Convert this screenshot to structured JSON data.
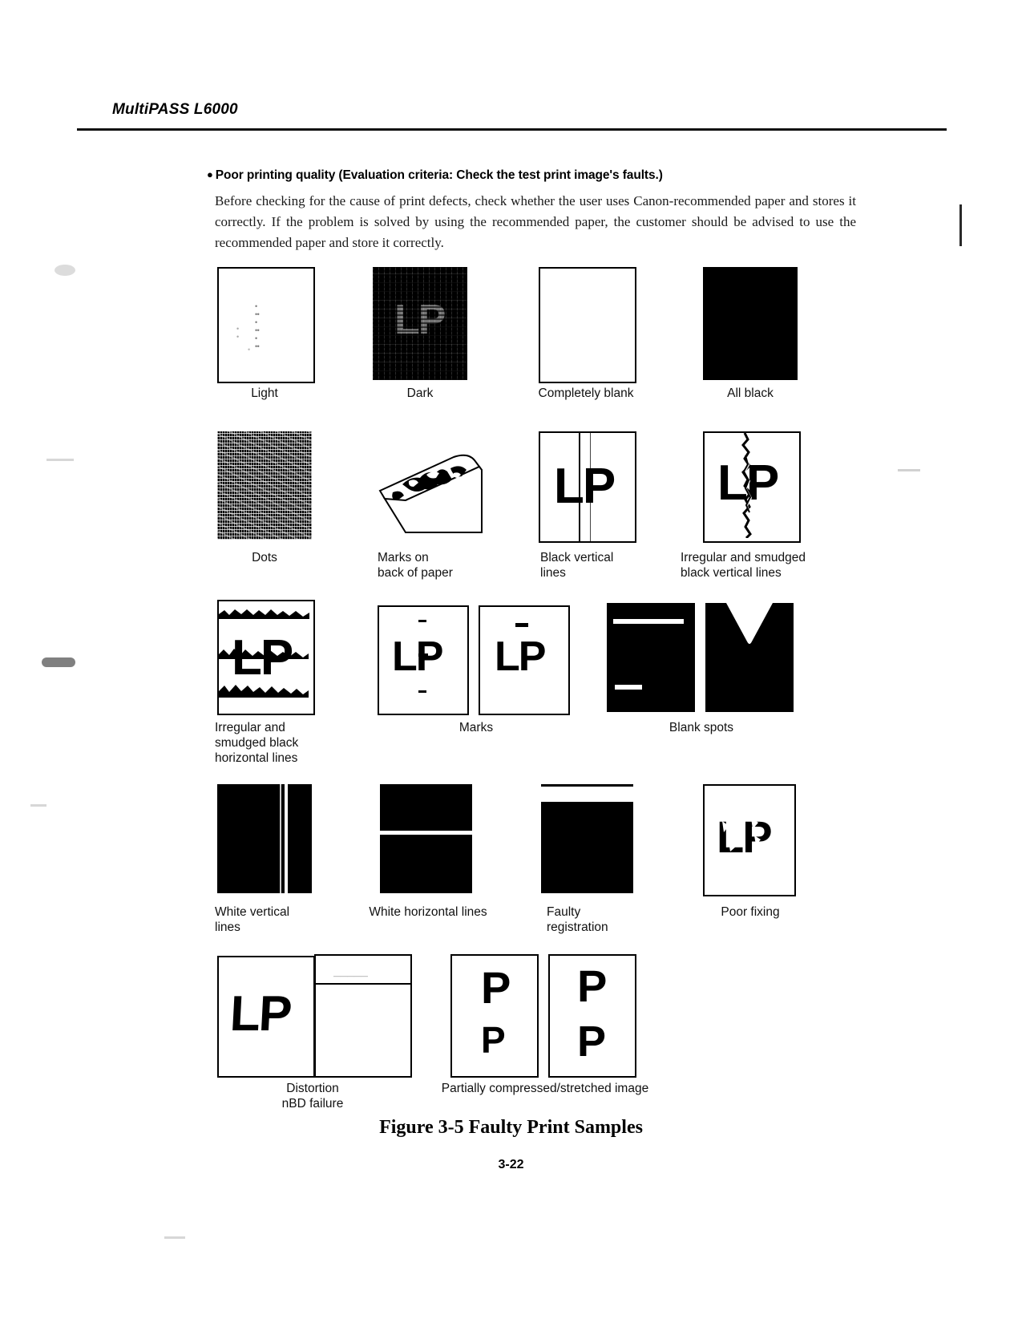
{
  "header": {
    "product_title": "MultiPASS L6000"
  },
  "intro": {
    "bullet_heading": "Poor printing quality (Evaluation criteria: Check the test print image's faults.)",
    "paragraph": "Before checking for the cause of print defects, check whether the user uses Canon-recommended paper and stores it correctly.  If the problem is solved by using the recommended paper, the customer should be advised to use the recommended paper and store it correctly."
  },
  "figure": {
    "title": "Figure 3-5 Faulty Print Samples",
    "rows": [
      {
        "captions": [
          "Light",
          "Dark",
          "Completely blank",
          "All black"
        ]
      },
      {
        "captions": [
          "Dots",
          "Marks on\nback of paper",
          "Black vertical\nlines",
          "Irregular and smudged\nblack vertical lines"
        ]
      },
      {
        "captions": [
          "Irregular and\nsmudged black\nhorizontal lines",
          "Marks",
          "Blank spots"
        ]
      },
      {
        "captions": [
          "White vertical\nlines",
          "White horizontal lines",
          "Faulty\nregistration",
          "Poor fixing"
        ]
      },
      {
        "captions": [
          "Distortion\nnBD failure",
          "Partially compressed/stretched image"
        ]
      }
    ],
    "sample_text": {
      "lp": "LP",
      "p": "P"
    }
  },
  "footer": {
    "page_number": "3-22"
  }
}
